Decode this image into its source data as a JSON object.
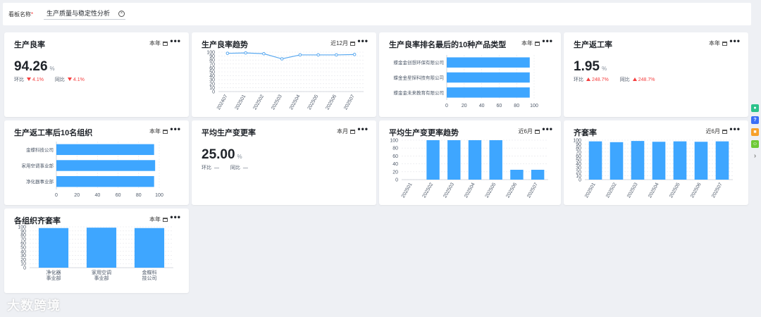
{
  "filter": {
    "label": "看板名称",
    "required_mark": "*",
    "value": "生产质量与稳定性分析"
  },
  "colors": {
    "bar": "#3ea6ff",
    "line": "#5aa9f0",
    "negative": "#f53f3f"
  },
  "more_label": "•••",
  "cards": {
    "yield": {
      "title": "生产良率",
      "period": "本年",
      "value": "94.26",
      "unit": "%",
      "mom_label": "环比",
      "mom": "4.1%",
      "yoy_label": "同比",
      "yoy": "4.1%",
      "mom_dir": "down",
      "yoy_dir": "down"
    },
    "yield_trend": {
      "title": "生产良率趋势",
      "period": "近12月"
    },
    "yield_rank": {
      "title": "生产良率排名最后的10种产品类型",
      "period": "本年"
    },
    "rework": {
      "title": "生产返工率",
      "period": "本年",
      "value": "1.95",
      "unit": "%",
      "mom_label": "环比",
      "mom": "248.7%",
      "yoy_label": "同比",
      "yoy": "248.7%",
      "mom_dir": "up",
      "yoy_dir": "up"
    },
    "rework_rank": {
      "title": "生产返工率后10名组织",
      "period": "本年"
    },
    "avg_change": {
      "title": "平均生产变更率",
      "period": "本月",
      "value": "25.00",
      "unit": "%",
      "mom_label": "环比",
      "mom": "—",
      "yoy_label": "同比",
      "yoy": "—"
    },
    "avg_change_trend": {
      "title": "平均生产变更率趋势",
      "period": "近6月"
    },
    "kit_rate": {
      "title": "齐套率",
      "period": "近6月"
    },
    "org_kit_rate": {
      "title": "各组织齐套率",
      "period": "本年"
    }
  },
  "brand_text": "大数跨境",
  "chart_data": [
    {
      "id": "yield_trend",
      "type": "line",
      "x": [
        "202407",
        "202501",
        "202502",
        "202503",
        "202504",
        "202505",
        "202506",
        "202507"
      ],
      "values": [
        97,
        98,
        96,
        83,
        93,
        93,
        93,
        94
      ],
      "yticks": [
        0,
        10,
        20,
        30,
        40,
        50,
        60,
        70,
        80,
        90,
        100
      ],
      "ylim": [
        0,
        100
      ]
    },
    {
      "id": "yield_rank",
      "type": "bar",
      "orientation": "horizontal",
      "categories": [
        "蝶金金创想环保有限公司",
        "蝶金金星探科技有限公司",
        "蝶金金未来教育有限公司"
      ],
      "values": [
        95,
        95,
        95
      ],
      "xticks": [
        0,
        20,
        40,
        60,
        80,
        100
      ],
      "xlim": [
        0,
        100
      ]
    },
    {
      "id": "rework_rank",
      "type": "bar",
      "orientation": "horizontal",
      "categories": [
        "金蝶科技公司",
        "家用空调事业部",
        "净化器事业部"
      ],
      "values": [
        95,
        96,
        95
      ],
      "xticks": [
        0,
        20,
        40,
        60,
        80,
        100
      ],
      "xlim": [
        0,
        100
      ]
    },
    {
      "id": "avg_change_trend",
      "type": "bar",
      "categories": [
        "202501",
        "202502",
        "202503",
        "202504",
        "202505",
        "202506",
        "202507"
      ],
      "values": [
        0,
        100,
        100,
        100,
        100,
        25,
        25
      ],
      "yticks": [
        0,
        20,
        40,
        60,
        80,
        100
      ],
      "ylim": [
        0,
        100
      ]
    },
    {
      "id": "kit_rate",
      "type": "bar",
      "categories": [
        "202501",
        "202502",
        "202503",
        "202504",
        "202505",
        "202506",
        "202507"
      ],
      "values": [
        97,
        95,
        98,
        96,
        97,
        96,
        97
      ],
      "yticks": [
        0,
        10,
        20,
        30,
        40,
        50,
        60,
        70,
        80,
        90,
        100
      ],
      "ylim": [
        0,
        100
      ]
    },
    {
      "id": "org_kit_rate",
      "type": "bar",
      "categories": [
        "净化器事业部",
        "家用空调事业部",
        "金蝶科技公司"
      ],
      "values": [
        97,
        98,
        97
      ],
      "yticks": [
        0,
        10,
        20,
        30,
        40,
        50,
        60,
        70,
        80,
        90,
        100
      ],
      "ylim": [
        0,
        100
      ]
    }
  ]
}
